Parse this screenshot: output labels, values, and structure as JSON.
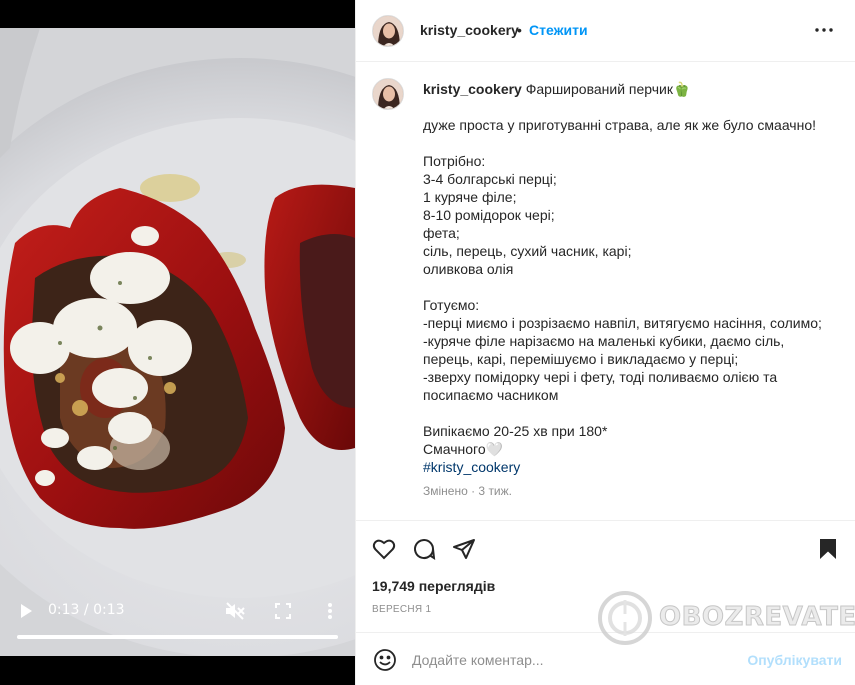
{
  "video": {
    "current_time": "0:13",
    "separator": "/",
    "duration": "0:13",
    "progress": 1.0,
    "muted": true,
    "controls": [
      "play-icon",
      "volume-muted-icon",
      "fullscreen-icon",
      "more-vert-icon"
    ]
  },
  "post": {
    "username": "kristy_cookery",
    "dot": "•",
    "follow_label": "Стежити",
    "more_icon": "more-horiz-icon",
    "caption": {
      "title": "Фарширований перчик🫑",
      "lines": [
        "дуже проста у приготуванні страва, але як же було смаачно!",
        "",
        "Потрібно:",
        "3-4 болгарські перці;",
        "1 куряче філе;",
        "8-10 ромідорок чері;",
        "фета;",
        "сіль, перець, сухий часник, карі;",
        "оливкова олія",
        "",
        "Готуємо:",
        "-перці миємо і розрізаємо навпіл, витягуємо насіння, солимо;",
        "-куряче філе нарізаємо на маленькі кубики, даємо сіль,",
        "перець, карі, перемішуємо і викладаємо у перці;",
        "-зверху помідорку чері і фету, тоді поливаємо олією та",
        "посипаємо часником",
        "",
        "Випікаємо 20-25 хв при 180*",
        "Смачного🤍"
      ],
      "hashtag": "#kristy_cookery",
      "edited": "Змінено · 3 тиж."
    },
    "actions": [
      "heart-icon",
      "comment-icon",
      "share-icon",
      "bookmark-icon"
    ],
    "views": "19,749 переглядів",
    "date": "ВЕРЕСНЯ 1"
  },
  "comment": {
    "emoji_icon": "emoji-icon",
    "placeholder": "Додайте коментар...",
    "publish_label": "Опублікувати"
  },
  "watermark": "OBOZREVATEL",
  "colors": {
    "accent": "#0095f6",
    "publish_disabled": "#b2dffc",
    "text": "#262626",
    "muted": "#8e8e8e",
    "hashtag": "#00376b"
  }
}
